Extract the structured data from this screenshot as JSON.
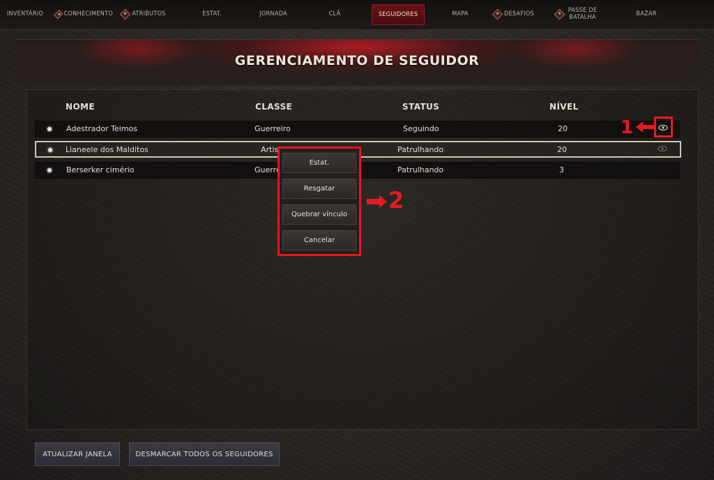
{
  "tabs": [
    {
      "label": "INVENTÁRIO",
      "icon": null,
      "active": false
    },
    {
      "label": "CONHECIMENTO",
      "icon": "diamond-icon",
      "active": false
    },
    {
      "label": "ATRIBUTOS",
      "icon": "diamond-icon",
      "active": false
    },
    {
      "label": "ESTAT.",
      "icon": null,
      "active": false
    },
    {
      "label": "JORNADA",
      "icon": null,
      "active": false
    },
    {
      "label": "CLÃ",
      "icon": null,
      "active": false
    },
    {
      "label": "SEGUIDORES",
      "icon": null,
      "active": true
    },
    {
      "label": "MAPA",
      "icon": null,
      "active": false
    },
    {
      "label": "DESAFIOS",
      "icon": "diamond-icon",
      "active": false
    },
    {
      "label": "PASSE DE BATALHA",
      "icon": "diamond-icon",
      "active": false
    },
    {
      "label": "BAZAR",
      "icon": null,
      "active": false
    }
  ],
  "page_title": "GERENCIAMENTO DE SEGUIDOR",
  "columns": {
    "name": "NOME",
    "class": "CLASSE",
    "status": "STATUS",
    "level": "NÍVEL"
  },
  "rows": [
    {
      "name": "Adestrador Teimos",
      "class": "Guerreiro",
      "status": "Seguindo",
      "level": "20",
      "selected": false
    },
    {
      "name": "Lianeele dos Malditos",
      "class": "Artis",
      "status": "Patrulhando",
      "level": "20",
      "selected": true
    },
    {
      "name": "Berserker cimério",
      "class": "Guerre",
      "status": "Patrulhando",
      "level": "3",
      "selected": false
    }
  ],
  "context_menu": {
    "items": [
      "Estat.",
      "Resgatar",
      "Quebrar vínculo",
      "Cancelar"
    ]
  },
  "annotations": {
    "marker_1": "1",
    "marker_2": "2"
  },
  "buttons": {
    "refresh": "ATUALIZAR JANELA",
    "unmark_all": "DESMARCAR TODOS OS SEGUIDORES"
  },
  "colors": {
    "accent_red": "#e51b22",
    "active_tab": "#5a1013"
  }
}
